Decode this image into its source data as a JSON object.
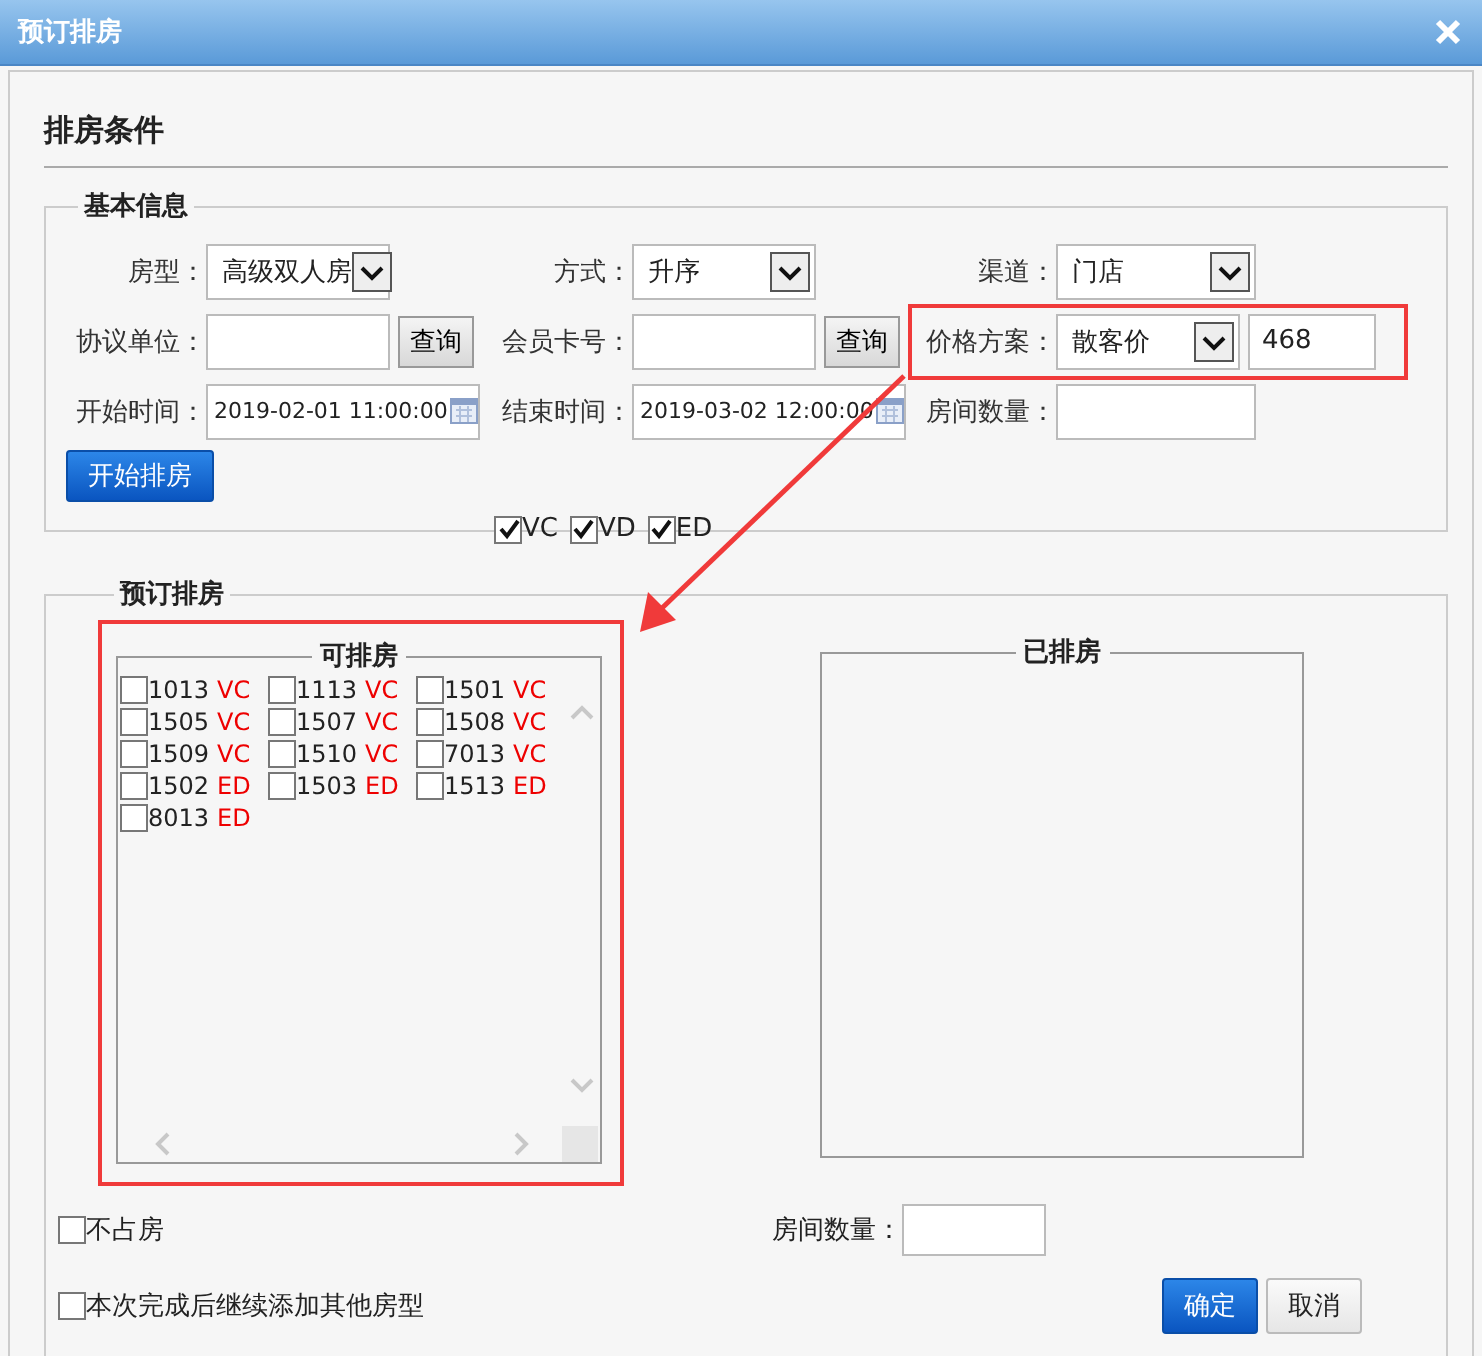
{
  "window": {
    "title": "预订排房"
  },
  "heading": "排房条件",
  "basic_info": {
    "legend": "基本信息",
    "rows": [
      [
        {
          "kind": "select",
          "label": "房型：",
          "value": "高级双人房"
        },
        {
          "kind": "select",
          "label": "方式：",
          "value": "升序"
        },
        {
          "kind": "select",
          "label": "渠道：",
          "value": "门店"
        }
      ],
      [
        {
          "kind": "lookup",
          "label": "协议单位：",
          "button": "查询"
        },
        {
          "kind": "lookup",
          "label": "会员卡号：",
          "button": "查询"
        },
        {
          "kind": "price",
          "label": "价格方案：",
          "value": "散客价",
          "amount": "468",
          "highlighted": true
        }
      ],
      [
        {
          "kind": "date",
          "label": "开始时间：",
          "value": "2019-02-01 11:00:00"
        },
        {
          "kind": "date",
          "label": "结束时间：",
          "value": "2019-03-02 12:00:00"
        },
        {
          "kind": "text",
          "label": "房间数量："
        }
      ]
    ],
    "start_button": "开始排房",
    "status_filters": [
      {
        "label": "VC",
        "checked": true
      },
      {
        "label": "VD",
        "checked": true
      },
      {
        "label": "ED",
        "checked": true
      }
    ]
  },
  "booking": {
    "legend": "预订排房",
    "available": {
      "title": "可排房",
      "highlighted": true,
      "rooms": [
        {
          "number": "1013",
          "status": "VC",
          "checked": false
        },
        {
          "number": "1113",
          "status": "VC",
          "checked": false
        },
        {
          "number": "1501",
          "status": "VC",
          "checked": false
        },
        {
          "number": "1505",
          "status": "VC",
          "checked": false
        },
        {
          "number": "1507",
          "status": "VC",
          "checked": false
        },
        {
          "number": "1508",
          "status": "VC",
          "checked": false
        },
        {
          "number": "1509",
          "status": "VC",
          "checked": false
        },
        {
          "number": "1510",
          "status": "VC",
          "checked": false
        },
        {
          "number": "7013",
          "status": "VC",
          "checked": false
        },
        {
          "number": "1502",
          "status": "ED",
          "checked": false
        },
        {
          "number": "1503",
          "status": "ED",
          "checked": false
        },
        {
          "number": "1513",
          "status": "ED",
          "checked": false
        },
        {
          "number": "8013",
          "status": "ED",
          "checked": false
        }
      ]
    },
    "assigned": {
      "title": "已排房"
    },
    "no_occupy": {
      "label": "不占房",
      "checked": false
    },
    "room_count": {
      "label": "房间数量："
    },
    "continue_add": {
      "label": "本次完成后继续添加其他房型",
      "checked": false
    },
    "buttons": [
      {
        "label": "确定",
        "kind": "primary"
      },
      {
        "label": "取消",
        "kind": "default"
      }
    ]
  }
}
